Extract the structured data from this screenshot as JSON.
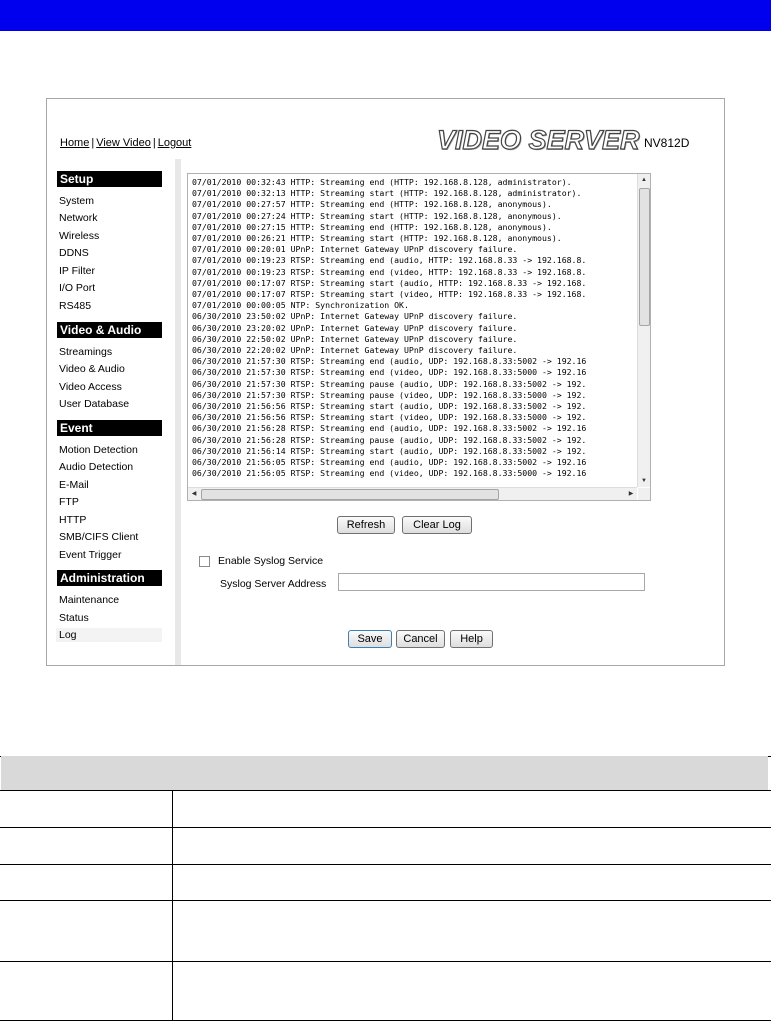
{
  "header": {
    "nav_home": "Home",
    "nav_view_video": "View Video",
    "nav_logout": "Logout",
    "separator": "|",
    "logo": "VIDEO SERVER",
    "model": "NV812D"
  },
  "sidebar": {
    "sections": [
      {
        "title": "Setup",
        "items": [
          "System",
          "Network",
          "Wireless",
          "DDNS",
          "IP Filter",
          "I/O Port",
          "RS485"
        ]
      },
      {
        "title": "Video & Audio",
        "items": [
          "Streamings",
          "Video & Audio",
          "Video Access",
          "User Database"
        ]
      },
      {
        "title": "Event",
        "items": [
          "Motion Detection",
          "Audio Detection",
          "E-Mail",
          "FTP",
          "HTTP",
          "SMB/CIFS Client",
          "Event Trigger"
        ]
      },
      {
        "title": "Administration",
        "items": [
          "Maintenance",
          "Status",
          "Log"
        ]
      }
    ],
    "active_item": "Log"
  },
  "log": {
    "lines": [
      "07/01/2010 00:32:43 HTTP: Streaming end (HTTP: 192.168.8.128, administrator).",
      "07/01/2010 00:32:13 HTTP: Streaming start (HTTP: 192.168.8.128, administrator).",
      "07/01/2010 00:27:57 HTTP: Streaming end (HTTP: 192.168.8.128, anonymous).",
      "07/01/2010 00:27:24 HTTP: Streaming start (HTTP: 192.168.8.128, anonymous).",
      "07/01/2010 00:27:15 HTTP: Streaming end (HTTP: 192.168.8.128, anonymous).",
      "07/01/2010 00:26:21 HTTP: Streaming start (HTTP: 192.168.8.128, anonymous).",
      "07/01/2010 00:20:01 UPnP: Internet Gateway UPnP discovery failure.",
      "07/01/2010 00:19:23 RTSP: Streaming end (audio, HTTP: 192.168.8.33 -> 192.168.8.",
      "07/01/2010 00:19:23 RTSP: Streaming end (video, HTTP: 192.168.8.33 -> 192.168.8.",
      "07/01/2010 00:17:07 RTSP: Streaming start (audio, HTTP: 192.168.8.33 -> 192.168.",
      "07/01/2010 00:17:07 RTSP: Streaming start (video, HTTP: 192.168.8.33 -> 192.168.",
      "07/01/2010 00:00:05 NTP: Synchronization OK.",
      "06/30/2010 23:50:02 UPnP: Internet Gateway UPnP discovery failure.",
      "06/30/2010 23:20:02 UPnP: Internet Gateway UPnP discovery failure.",
      "06/30/2010 22:50:02 UPnP: Internet Gateway UPnP discovery failure.",
      "06/30/2010 22:20:02 UPnP: Internet Gateway UPnP discovery failure.",
      "06/30/2010 21:57:30 RTSP: Streaming end (audio, UDP: 192.168.8.33:5002 -> 192.16",
      "06/30/2010 21:57:30 RTSP: Streaming end (video, UDP: 192.168.8.33:5000 -> 192.16",
      "06/30/2010 21:57:30 RTSP: Streaming pause (audio, UDP: 192.168.8.33:5002 -> 192.",
      "06/30/2010 21:57:30 RTSP: Streaming pause (video, UDP: 192.168.8.33:5000 -> 192.",
      "06/30/2010 21:56:56 RTSP: Streaming start (audio, UDP: 192.168.8.33:5002 -> 192.",
      "06/30/2010 21:56:56 RTSP: Streaming start (video, UDP: 192.168.8.33:5000 -> 192.",
      "06/30/2010 21:56:28 RTSP: Streaming end (audio, UDP: 192.168.8.33:5002 -> 192.16",
      "06/30/2010 21:56:28 RTSP: Streaming pause (audio, UDP: 192.168.8.33:5002 -> 192.",
      "06/30/2010 21:56:14 RTSP: Streaming start (audio, UDP: 192.168.8.33:5002 -> 192.",
      "06/30/2010 21:56:05 RTSP: Streaming end (audio, UDP: 192.168.8.33:5002 -> 192.16",
      "06/30/2010 21:56:05 RTSP: Streaming end (video, UDP: 192.168.8.33:5000 -> 192.16"
    ]
  },
  "buttons": {
    "refresh": "Refresh",
    "clear_log": "Clear Log",
    "save": "Save",
    "cancel": "Cancel",
    "help": "Help"
  },
  "syslog": {
    "enable_label": "Enable Syslog Service",
    "enabled": false,
    "server_label": "Syslog Server Address",
    "server_value": ""
  },
  "scroll_icons": {
    "up": "▲",
    "down": "▼",
    "left": "◀",
    "right": "▶",
    "grip_v": "≡",
    "grip_h": "|||"
  },
  "colors": {
    "banner": "#0000ee",
    "sidebar_header_bg": "#000000",
    "table_header_bg": "#d9d9d9"
  }
}
